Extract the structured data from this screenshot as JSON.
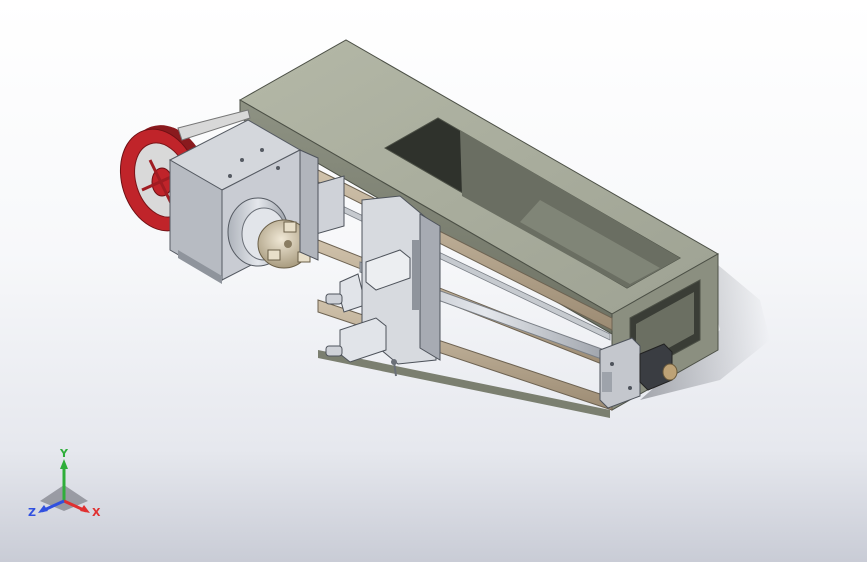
{
  "viewport": {
    "background_top": "#ffffff",
    "background_bottom": "#c9ccd6"
  },
  "model": {
    "parts": [
      "base-frame",
      "pulley",
      "headstock",
      "chuck",
      "carriage",
      "tool-posts",
      "guide-rails",
      "lead-screw",
      "stepper-motor"
    ],
    "colors": {
      "frame": "#a9ad9c",
      "frame_dark": "#7b7f70",
      "metal": "#c9cdd4",
      "metal_dark": "#8f949c",
      "pulley": "#c0242a",
      "rail": "#b6a48c",
      "chuck": "#d9cdb4"
    }
  },
  "triad": {
    "x_label": "X",
    "y_label": "Y",
    "z_label": "Z",
    "x_color": "#e03030",
    "y_color": "#2fae3a",
    "z_color": "#3050e0"
  }
}
